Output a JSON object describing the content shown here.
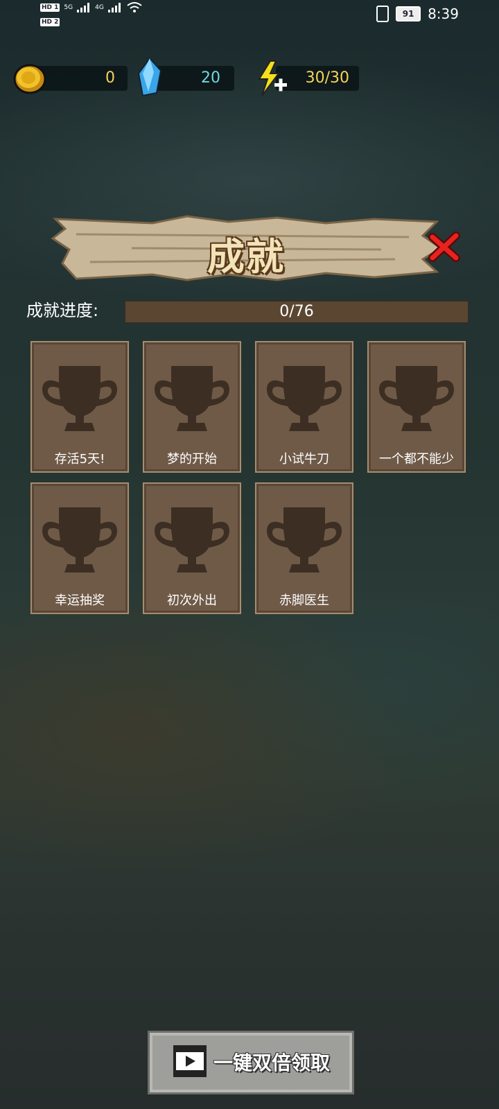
{
  "status_bar": {
    "hd1": "HD 1",
    "hd2": "HD 2",
    "net1": "5G",
    "net2": "4G",
    "battery": "91",
    "time": "8:39"
  },
  "resources": {
    "gold": "0",
    "gems": "20",
    "energy": "30/30"
  },
  "panel": {
    "title": "成就",
    "progress_label": "成就进度:",
    "progress_text": "0/76",
    "progress_fraction": 0
  },
  "achievements": [
    {
      "label": "存活5天!"
    },
    {
      "label": "梦的开始"
    },
    {
      "label": "小试牛刀"
    },
    {
      "label": "一个都不能少"
    },
    {
      "label": "幸运抽奖"
    },
    {
      "label": "初次外出"
    },
    {
      "label": "赤脚医生"
    }
  ],
  "claim_button": {
    "label": "一键双倍领取"
  },
  "colors": {
    "gold_text": "#f3d55a",
    "gem_text": "#6fd8e0",
    "card_bg": "#6f5a48",
    "trophy": "#3d2e23"
  }
}
